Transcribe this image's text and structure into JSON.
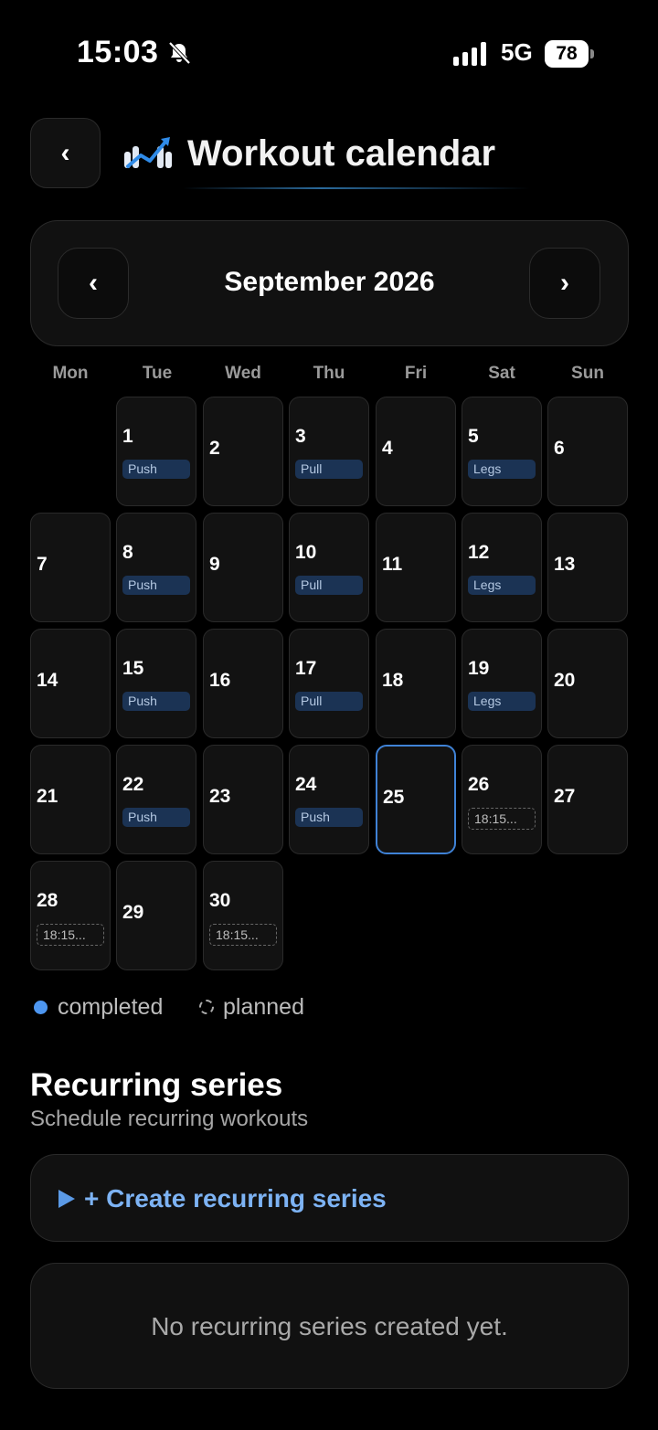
{
  "status_bar": {
    "time": "15:03",
    "network": "5G",
    "battery": "78"
  },
  "header": {
    "back_icon": "‹",
    "title": "Workout calendar",
    "title_icon": "chart-trend-icon"
  },
  "calendar": {
    "month_label": "September 2026",
    "prev_icon": "‹",
    "next_icon": "›",
    "weekdays": [
      "Mon",
      "Tue",
      "Wed",
      "Thu",
      "Fri",
      "Sat",
      "Sun"
    ],
    "days": [
      {
        "num": "1",
        "tag": "Push"
      },
      {
        "num": "2"
      },
      {
        "num": "3",
        "tag": "Pull"
      },
      {
        "num": "4"
      },
      {
        "num": "5",
        "tag": "Legs"
      },
      {
        "num": "6"
      },
      {
        "num": "7"
      },
      {
        "num": "8",
        "tag": "Push"
      },
      {
        "num": "9"
      },
      {
        "num": "10",
        "tag": "Pull"
      },
      {
        "num": "11"
      },
      {
        "num": "12",
        "tag": "Legs"
      },
      {
        "num": "13"
      },
      {
        "num": "14"
      },
      {
        "num": "15",
        "tag": "Push"
      },
      {
        "num": "16"
      },
      {
        "num": "17",
        "tag": "Pull"
      },
      {
        "num": "18"
      },
      {
        "num": "19",
        "tag": "Legs"
      },
      {
        "num": "20"
      },
      {
        "num": "21"
      },
      {
        "num": "22",
        "tag": "Push"
      },
      {
        "num": "23"
      },
      {
        "num": "24",
        "tag": "Push"
      },
      {
        "num": "25",
        "today": true
      },
      {
        "num": "26",
        "planned": "18:15..."
      },
      {
        "num": "27"
      },
      {
        "num": "28",
        "planned": "18:15..."
      },
      {
        "num": "29"
      },
      {
        "num": "30",
        "planned": "18:15..."
      }
    ],
    "first_weekday_offset": 1
  },
  "legend": {
    "completed": "completed",
    "planned": "planned",
    "completed_color": "#4d96f0"
  },
  "recurring": {
    "title": "Recurring series",
    "subtitle": "Schedule recurring workouts",
    "create_label": "+ Create recurring series",
    "empty_text": "No recurring series created yet."
  }
}
